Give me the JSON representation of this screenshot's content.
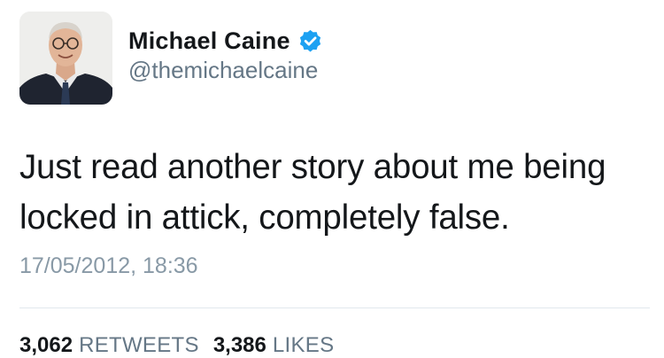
{
  "author": {
    "display_name": "Michael Caine",
    "handle": "@themichaelcaine",
    "verified": true,
    "avatar_icon": "profile-photo",
    "verified_icon": "verified-badge-icon"
  },
  "tweet": {
    "text": "Just read another story about me being locked in attick, completely false.",
    "timestamp": "17/05/2012, 18:36"
  },
  "stats": {
    "retweets_count": "3,062",
    "retweets_label": "RETWEETS",
    "likes_count": "3,386",
    "likes_label": "LIKES"
  },
  "colors": {
    "verified_blue": "#1da1f2",
    "text_primary": "#14171a",
    "text_secondary": "#657786",
    "timestamp_gray": "#8899a6",
    "divider": "#e1e8ed"
  }
}
